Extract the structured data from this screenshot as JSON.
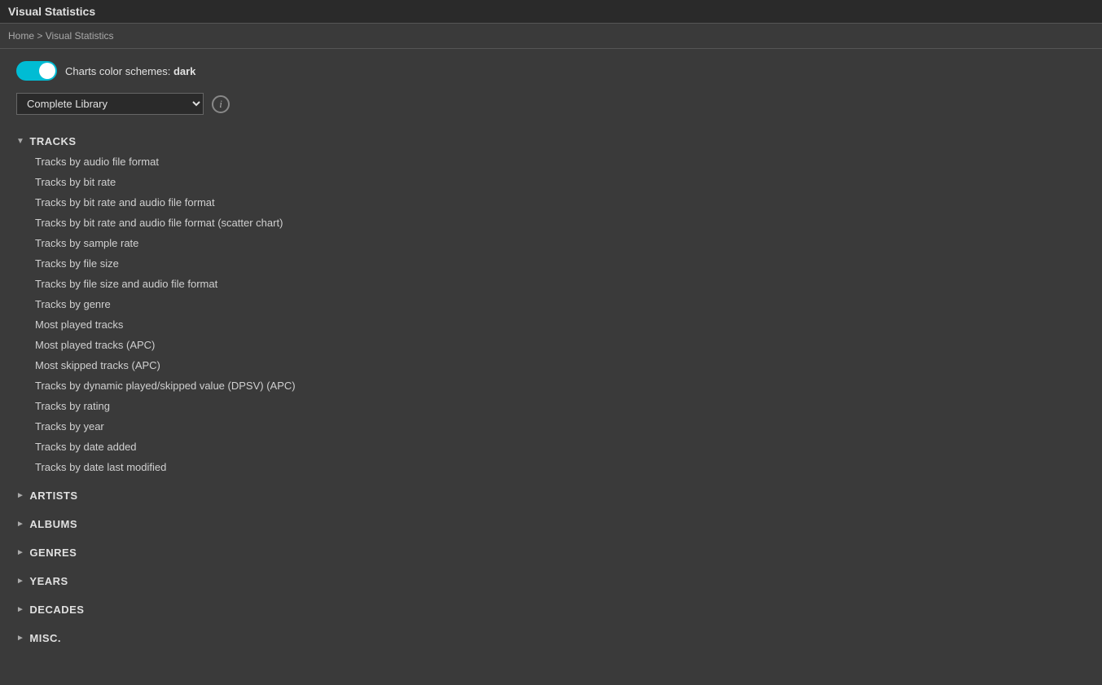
{
  "titleBar": {
    "title": "Visual Statistics"
  },
  "breadcrumb": {
    "home": "Home",
    "separator": ">",
    "current": "Visual Statistics"
  },
  "toggleRow": {
    "label": "Charts color schemes: ",
    "value": "dark"
  },
  "librarySelect": {
    "value": "Complete Library",
    "options": [
      "Complete Library"
    ]
  },
  "infoIcon": {
    "label": "i"
  },
  "sections": [
    {
      "id": "tracks",
      "label": "TRACKS",
      "expanded": true,
      "arrow": "▼",
      "items": [
        "Tracks by audio file format",
        "Tracks by bit rate",
        "Tracks by bit rate and audio file format",
        "Tracks by bit rate and audio file format (scatter chart)",
        "Tracks by sample rate",
        "Tracks by file size",
        "Tracks by file size and audio file format",
        "Tracks by genre",
        "Most played tracks",
        "Most played tracks (APC)",
        "Most skipped tracks (APC)",
        "Tracks by dynamic played/skipped value (DPSV) (APC)",
        "Tracks by rating",
        "Tracks by year",
        "Tracks by date added",
        "Tracks by date last modified"
      ]
    },
    {
      "id": "artists",
      "label": "ARTISTS",
      "expanded": false,
      "arrow": "►",
      "items": []
    },
    {
      "id": "albums",
      "label": "ALBUMS",
      "expanded": false,
      "arrow": "►",
      "items": []
    },
    {
      "id": "genres",
      "label": "GENRES",
      "expanded": false,
      "arrow": "►",
      "items": []
    },
    {
      "id": "years",
      "label": "YEARS",
      "expanded": false,
      "arrow": "►",
      "items": []
    },
    {
      "id": "decades",
      "label": "DECADES",
      "expanded": false,
      "arrow": "►",
      "items": []
    },
    {
      "id": "misc",
      "label": "MISC.",
      "expanded": false,
      "arrow": "►",
      "items": []
    }
  ]
}
